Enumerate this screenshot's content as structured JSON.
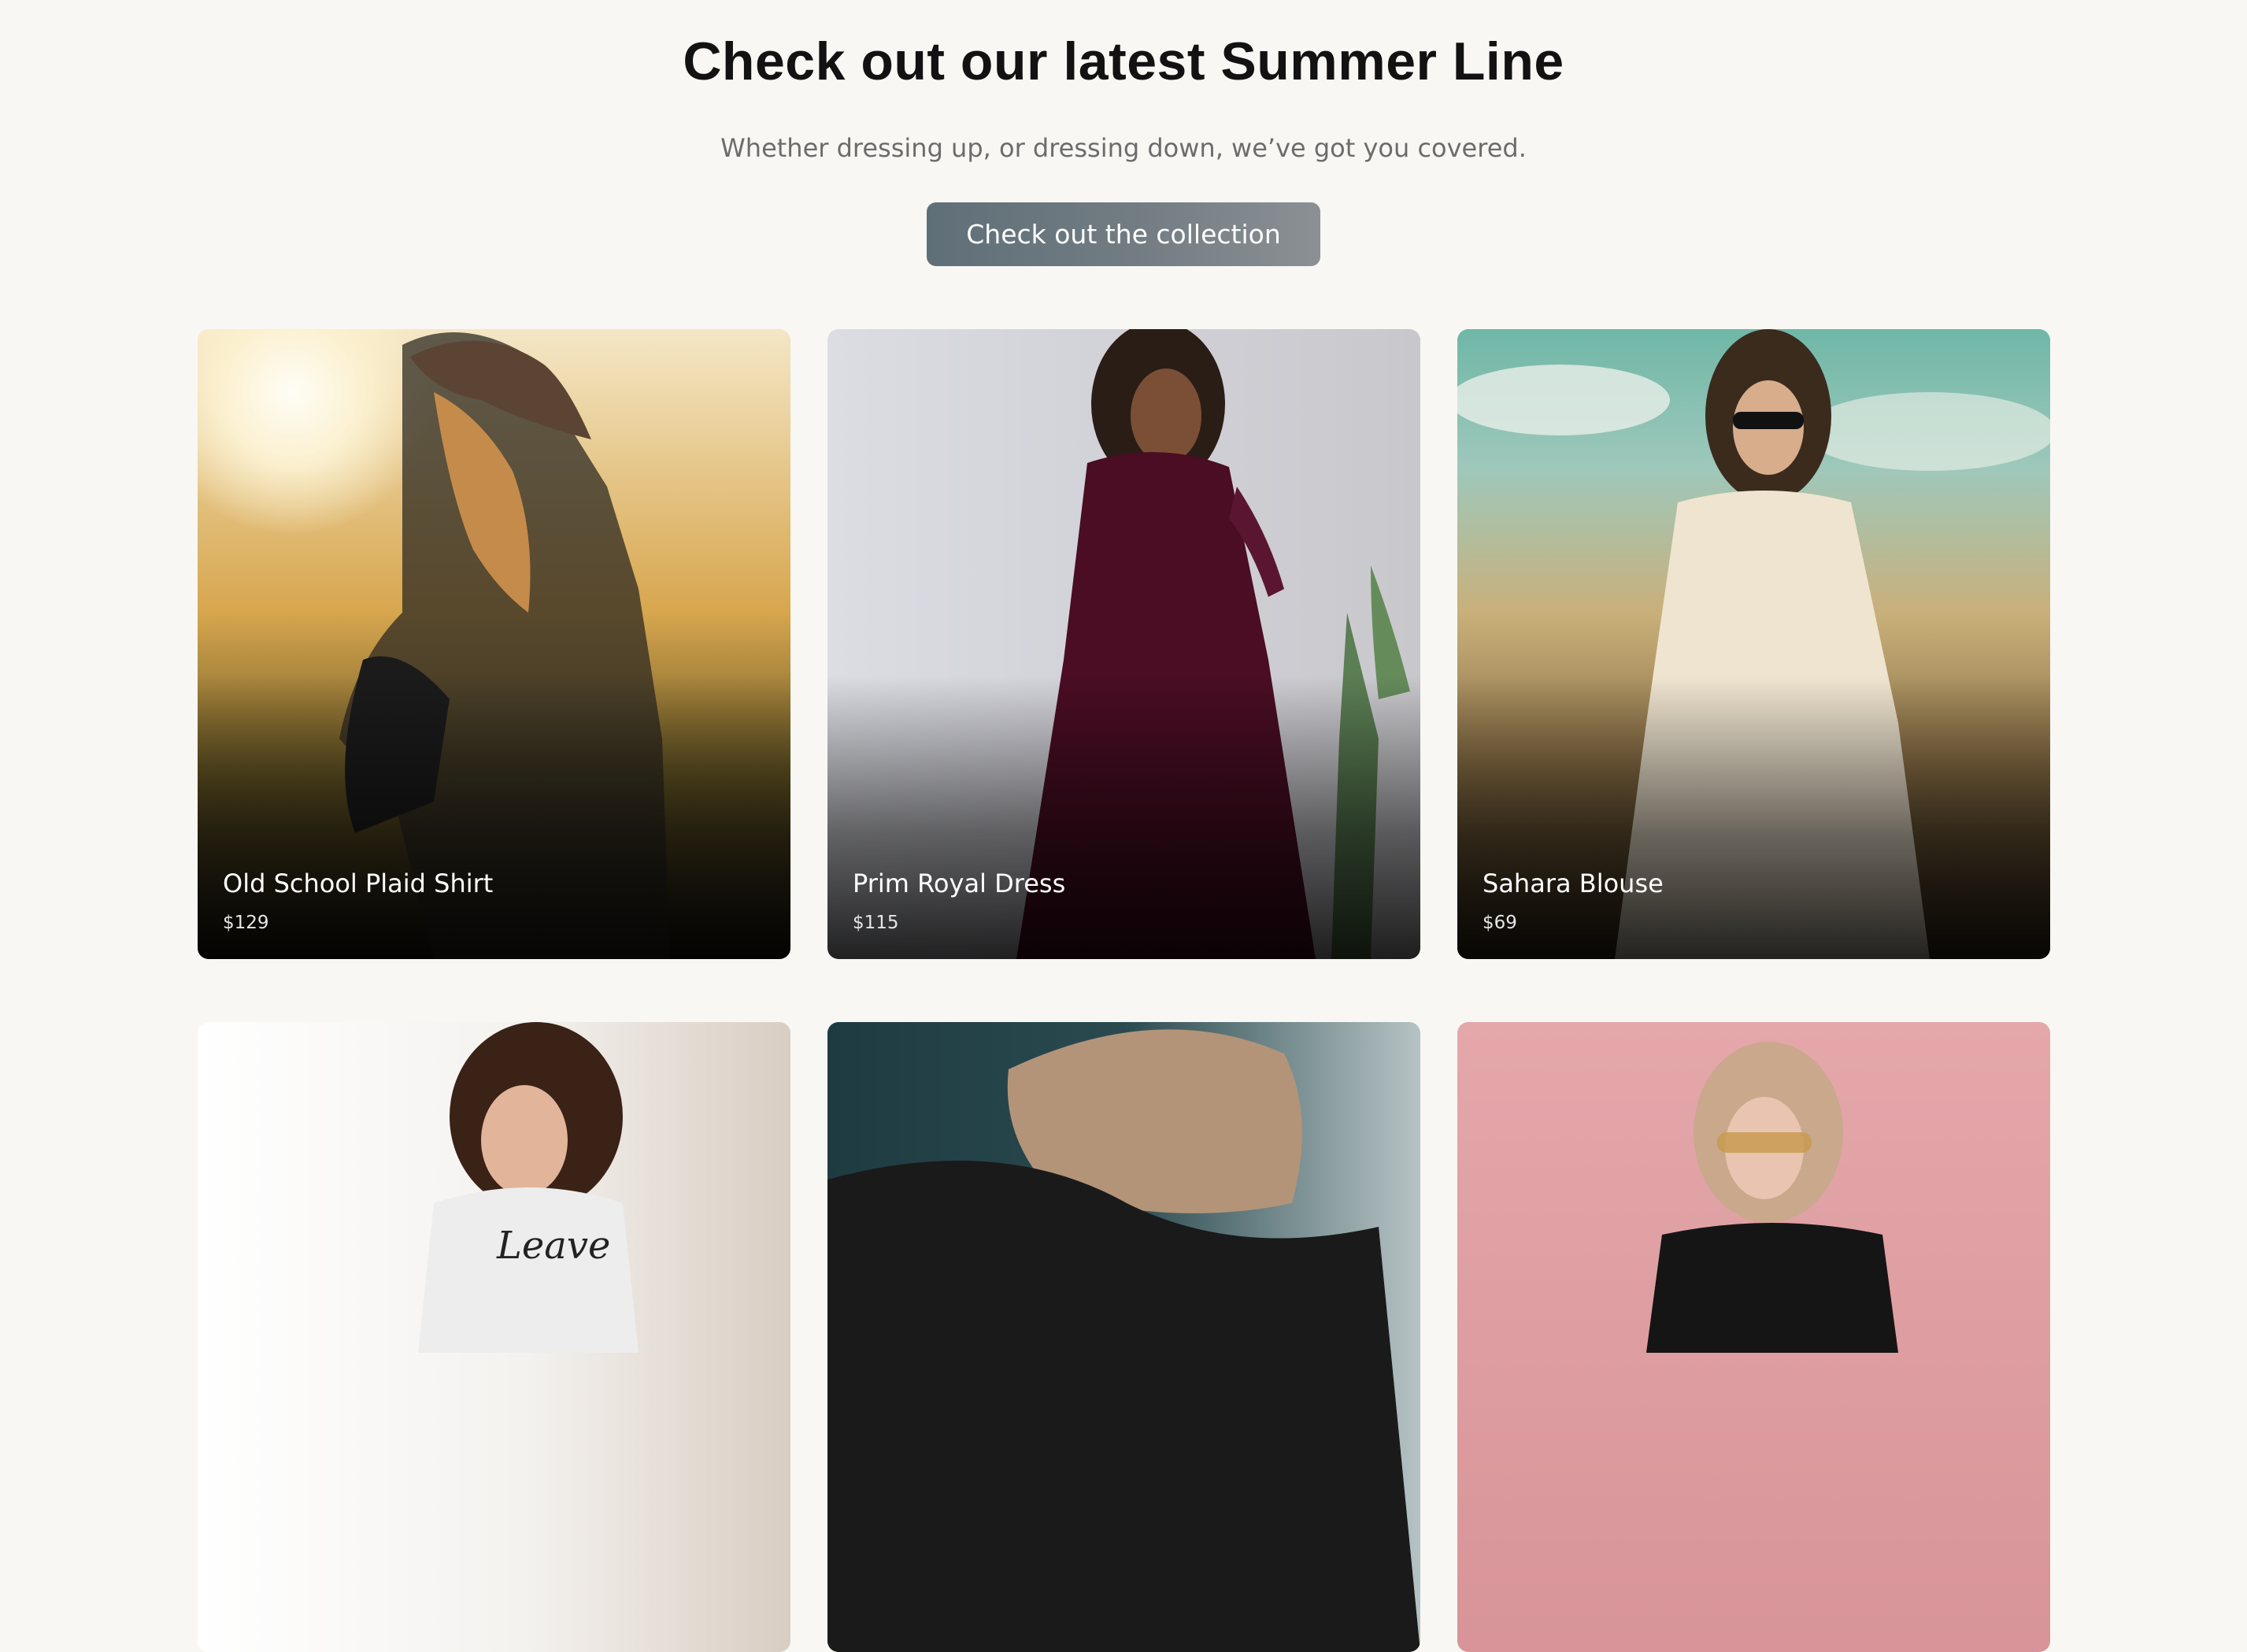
{
  "hero": {
    "title": "Check out our latest Summer Line",
    "subtitle": "Whether dressing up, or dressing down, we’ve got you covered.",
    "cta_label": "Check out the collection"
  },
  "products": [
    {
      "name": "Old School Plaid Shirt",
      "price": "$129"
    },
    {
      "name": "Prim Royal Dress",
      "price": "$115"
    },
    {
      "name": "Sahara Blouse",
      "price": "$69"
    },
    {
      "name": "",
      "price": ""
    },
    {
      "name": "",
      "price": ""
    },
    {
      "name": "",
      "price": ""
    }
  ],
  "colors": {
    "background": "#f8f7f3",
    "title_text": "#121212",
    "subtitle_text": "#6c6c6c",
    "cta_start": "#5f6f78",
    "cta_end": "#8b9094"
  }
}
